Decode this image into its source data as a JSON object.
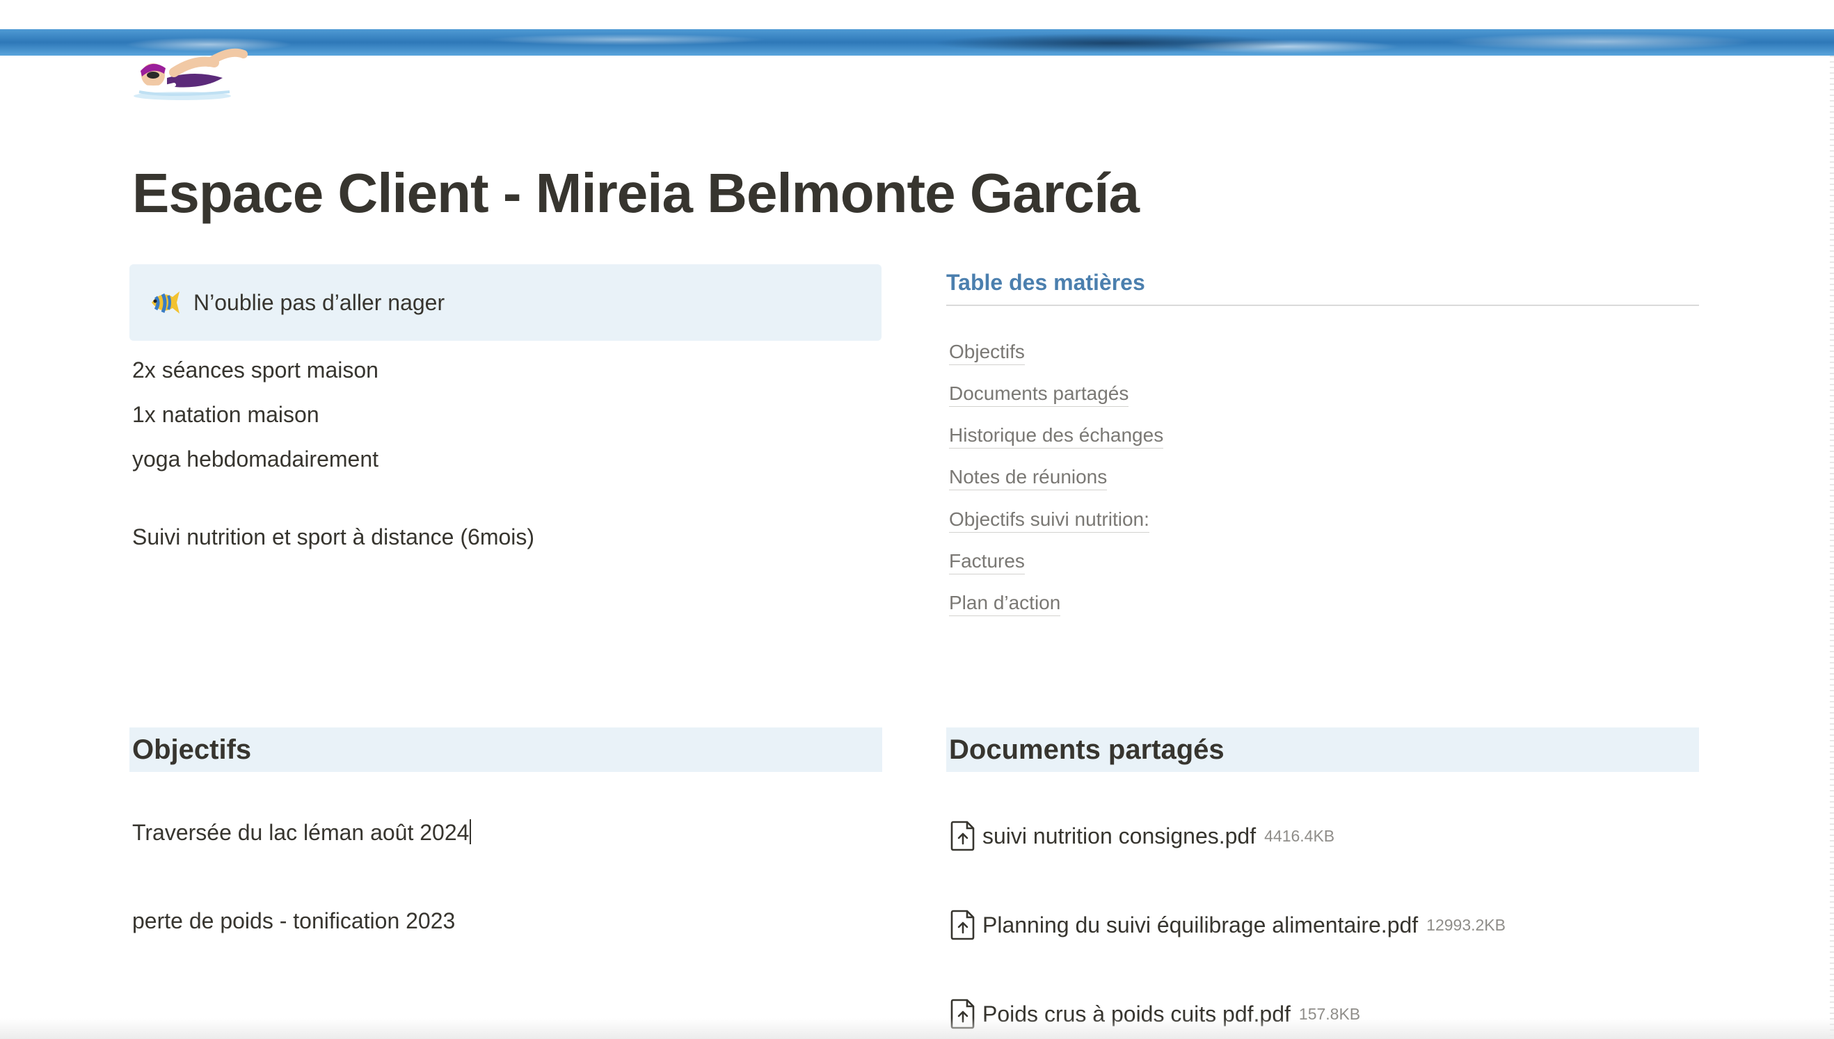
{
  "page": {
    "title": "Espace Client - Mireia Belmonte García",
    "icon": "swimmer-icon",
    "cover": "pool-water-cover"
  },
  "callout": {
    "icon": "tropical-fish-icon",
    "text": "N’oublie pas d’aller nager"
  },
  "intro_lines": [
    "2x séances sport maison",
    "1x natation maison",
    "yoga hebdomadairement",
    "Suivi nutrition et sport à distance (6mois)"
  ],
  "toc": {
    "title": "Table des matières",
    "items": [
      "Objectifs",
      "Documents partagés",
      "Historique des échanges",
      "Notes de réunions",
      "Objectifs suivi nutrition:",
      "Factures",
      "Plan d’action"
    ]
  },
  "objectifs": {
    "heading": "Objectifs",
    "items": [
      "Traversée du lac léman août 2024",
      "perte de poids - tonification 2023"
    ]
  },
  "documents": {
    "heading": "Documents partagés",
    "files": [
      {
        "name": "suivi nutrition consignes.pdf",
        "size": "4416.4KB"
      },
      {
        "name": "Planning du suivi équilibrage alimentaire.pdf",
        "size": "12993.2KB"
      },
      {
        "name": "Poids crus à poids cuits pdf.pdf",
        "size": "157.8KB"
      }
    ]
  },
  "colors": {
    "callout_bg": "#e9f2f8",
    "toc_title": "#4b7fae",
    "text": "#37352f",
    "muted": "#7a7874"
  }
}
